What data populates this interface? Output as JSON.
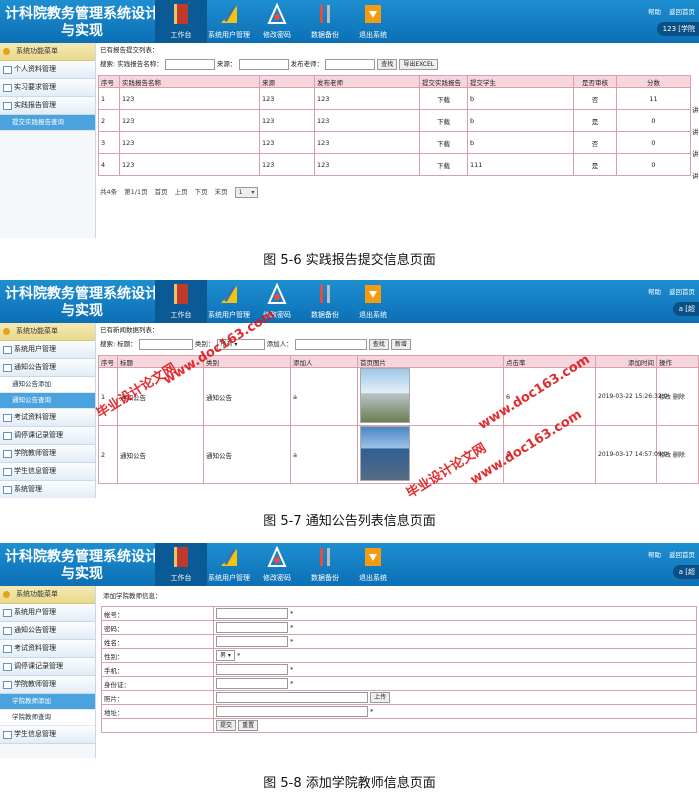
{
  "header": {
    "app_title": "计科院教务管理系统设计与实现",
    "nav": [
      {
        "label": "工作台",
        "icon": "book-icon"
      },
      {
        "label": "系统用户管理",
        "icon": "ruler-pencil-icon"
      },
      {
        "label": "修改密码",
        "icon": "tools-icon"
      },
      {
        "label": "数据备份",
        "icon": "wrench-screwdriver-icon"
      },
      {
        "label": "退出系统",
        "icon": "download-icon"
      }
    ],
    "help": "帮助",
    "home": "返回首页"
  },
  "shot1": {
    "user": "123 [学院",
    "sidebar_title": "系统功能菜单",
    "sidebar_items": [
      "个人资料管理",
      "实习要求管理",
      "实践报告管理"
    ],
    "sidebar_sub": "提交实践报告查询",
    "crumb": "已有报告提交列表：",
    "search": {
      "l1": "搜索: 实践报告名称：",
      "l2": "来源：",
      "l3": "发布老师：",
      "btn_search": "查找",
      "btn_export": "导出EXCEL"
    },
    "columns": [
      "序号",
      "实践报告名称",
      "来源",
      "发布老师",
      "提交实践报告",
      "提交学生",
      "是否审核",
      "分数"
    ],
    "rows": [
      [
        "1",
        "123",
        "123",
        "123",
        "下载",
        "b",
        "否",
        "11"
      ],
      [
        "2",
        "123",
        "123",
        "123",
        "下载",
        "b",
        "是",
        "0"
      ],
      [
        "3",
        "123",
        "123",
        "123",
        "下载",
        "b",
        "否",
        "0"
      ],
      [
        "4",
        "123",
        "123",
        "123",
        "下载",
        "111",
        "是",
        "0"
      ]
    ],
    "edge_text": "讲",
    "pager": {
      "total": "共4条",
      "page": "第1/1页",
      "first": "首页",
      "prev": "上页",
      "next": "下页",
      "last": "末页",
      "select": "1"
    },
    "caption": "图 5-6 实践报告提交信息页面"
  },
  "shot2": {
    "user": "a [超",
    "sidebar_title": "系统功能菜单",
    "sidebar_items": [
      "系统用户管理",
      "通知公告管理"
    ],
    "sidebar_subs": [
      "通知公告添加",
      "通知公告查询"
    ],
    "sidebar_items2": [
      "考试资料管理",
      "调停课记录管理",
      "学院教师管理",
      "学生信息管理",
      "系统管理"
    ],
    "crumb": "已有新闻数据列表：",
    "search": {
      "l1": "搜索: 标题：",
      "l2": "类别：",
      "select": "所有",
      "l3": "添加人：",
      "btn_search": "查找",
      "btn_new": "新增"
    },
    "columns": [
      "序号",
      "标题",
      "类别",
      "添加人",
      "首页图片",
      "点击率",
      "添加时间",
      "操作"
    ],
    "rows": [
      {
        "no": "1",
        "title": "通知公告",
        "cat": "通知公告",
        "by": "a",
        "hits": "6",
        "time": "2019-03-22 15:26:32.0",
        "op": "修改 删除"
      },
      {
        "no": "2",
        "title": "通知公告",
        "cat": "通知公告",
        "by": "a",
        "hits": "5",
        "time": "2019-03-17 14:57:09.0",
        "op": "修改 删除"
      }
    ],
    "watermarks": [
      "毕业设计论文网",
      "www.doc163.com"
    ],
    "caption": "图 5-7 通知公告列表信息页面"
  },
  "shot3": {
    "user": "a [超",
    "sidebar_title": "系统功能菜单",
    "sidebar_items": [
      "系统用户管理",
      "通知公告管理",
      "考试资料管理",
      "调停课记录管理",
      "学院教师管理"
    ],
    "sidebar_subs": [
      "学院教师添加",
      "学院教师查询"
    ],
    "sidebar_items2": [
      "学生信息管理"
    ],
    "crumb": "添加学院教师信息：",
    "fields": [
      "帐号：",
      "密码：",
      "姓名：",
      "性别：",
      "手机：",
      "身份证：",
      "照片：",
      "地址："
    ],
    "gender_value": "男",
    "upload": "上传",
    "submit": "提交",
    "reset": "重置",
    "required": "*",
    "caption": "图 5-8 添加学院教师信息页面"
  }
}
